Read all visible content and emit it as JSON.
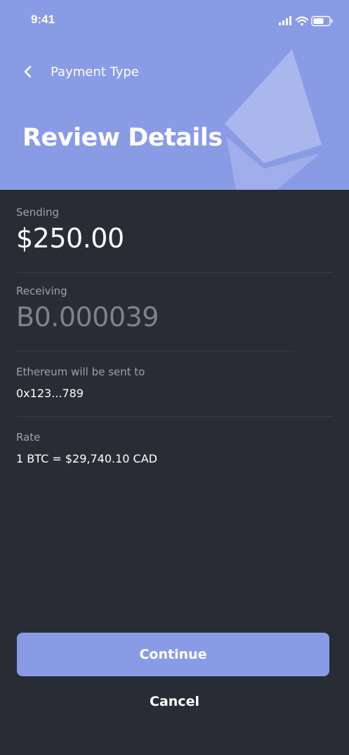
{
  "status_bar": {
    "time": "9:41"
  },
  "header": {
    "back_label": "Payment Type",
    "title": "Review Details",
    "background_color": "#8a9be6",
    "logo_icon": "ethereum-icon"
  },
  "details": {
    "sending": {
      "label": "Sending",
      "value": "$250.00"
    },
    "receiving": {
      "label": "Receiving",
      "value": "B0.000039"
    },
    "destination": {
      "label": "Ethereum will be sent to",
      "value": "0x123...789"
    },
    "rate": {
      "label": "Rate",
      "value": "1 BTC = $29,740.10 CAD"
    }
  },
  "actions": {
    "continue_label": "Continue",
    "cancel_label": "Cancel",
    "accent_color": "#8a9be6"
  }
}
